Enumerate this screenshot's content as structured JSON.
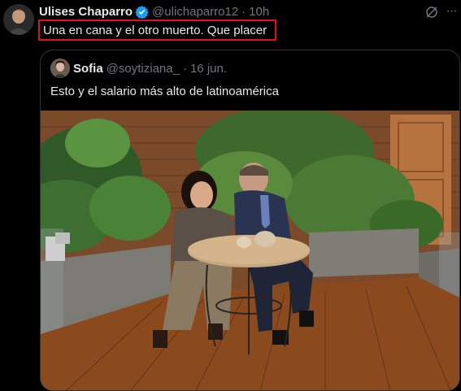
{
  "tweet": {
    "author_name": "Ulises Chaparro",
    "handle": "@ulichaparro12",
    "separator": "·",
    "time": "10h",
    "text": "Una en cana y el otro muerto. Que placer"
  },
  "quoted": {
    "author_name": "Sofia",
    "handle": "@soytiziana_",
    "separator": "·",
    "time": "16 jun.",
    "text": "Esto y el salario más alto de latinoamérica"
  },
  "colors": {
    "background": "#000000",
    "text": "#e7e9ea",
    "muted": "#71767b",
    "verified": "#1d9bf0",
    "highlight_border": "#e1101a"
  },
  "icons": {
    "verified": "verified-badge-icon",
    "grok": "grok-icon",
    "more": "more-icon"
  }
}
